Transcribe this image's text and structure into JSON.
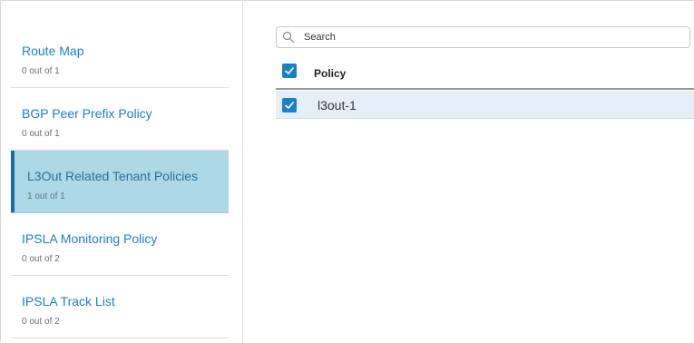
{
  "sidebar": {
    "items": [
      {
        "title": "Route Map",
        "subtitle": "0 out of 1"
      },
      {
        "title": "BGP Peer Prefix Policy",
        "subtitle": "0 out of 1"
      },
      {
        "title": "L3Out Related Tenant Policies",
        "subtitle": "1 out of 1",
        "active": true
      },
      {
        "title": "IPSLA Monitoring Policy",
        "subtitle": "0 out of 2"
      },
      {
        "title": "IPSLA Track List",
        "subtitle": "0 out of 2"
      }
    ]
  },
  "main": {
    "search": {
      "placeholder": "Search",
      "icon": "search-icon"
    },
    "table": {
      "header_checked": true,
      "columns": [
        "Policy"
      ],
      "rows": [
        {
          "checked": true,
          "policy": "l3out-1"
        }
      ]
    }
  },
  "colors": {
    "accent": "#1d80c0",
    "active_bg": "#add8e6",
    "row_selected_bg": "#e6eef9"
  }
}
